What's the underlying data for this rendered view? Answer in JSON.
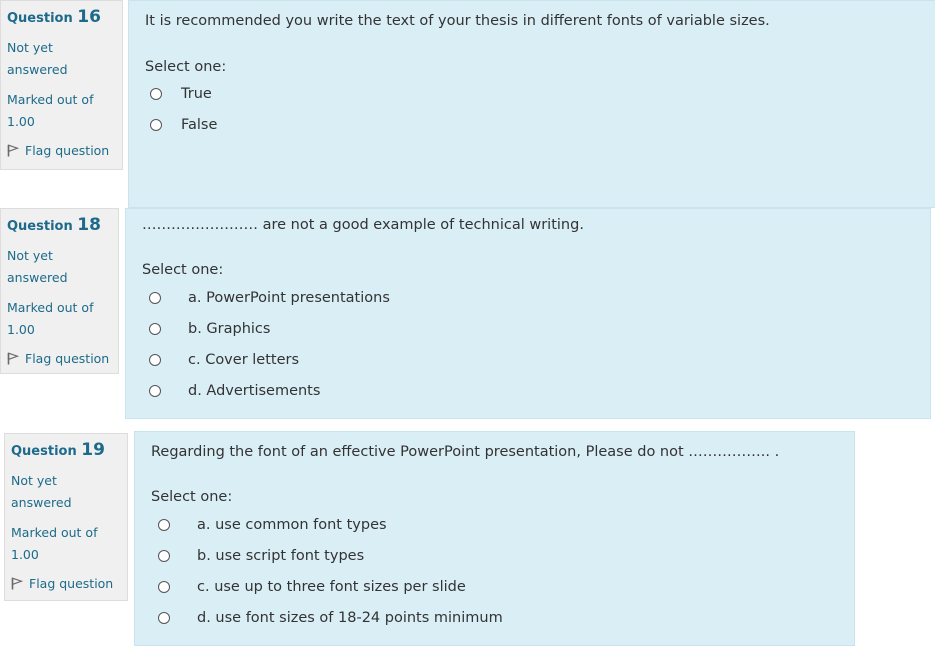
{
  "questions": [
    {
      "label": "Question",
      "number": "16",
      "state": "Not yet answered",
      "grade": "Marked out of 1.00",
      "flag": "Flag question",
      "text": "It is recommended you write the text of your thesis in different fonts of variable sizes.",
      "prompt": "Select one:",
      "options": [
        "True",
        "False"
      ]
    },
    {
      "label": "Question",
      "number": "18",
      "state": "Not yet answered",
      "grade": "Marked out of 1.00",
      "flag": "Flag question",
      "text": "…………………… are not a good example of technical writing.",
      "prompt": "Select one:",
      "options": [
        "a. PowerPoint presentations",
        "b. Graphics",
        "c. Cover letters",
        "d. Advertisements"
      ]
    },
    {
      "label": "Question",
      "number": "19",
      "state": "Not yet answered",
      "grade": "Marked out of 1.00",
      "flag": "Flag question",
      "text": "Regarding the font of an effective PowerPoint presentation, Please do not …………….. .",
      "prompt": "Select one:",
      "options": [
        "a. use common font types",
        "b. use script font types",
        "c. use up to three font sizes per slide",
        "d. use font sizes of 18-24 points minimum"
      ]
    }
  ]
}
